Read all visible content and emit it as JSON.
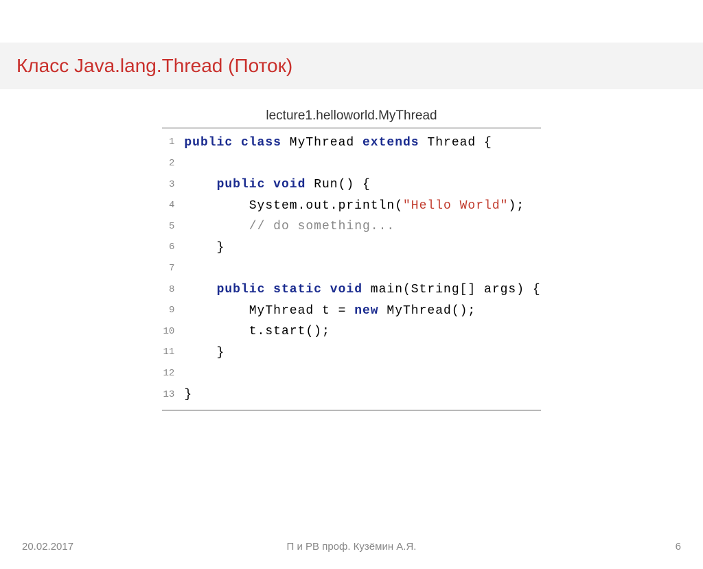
{
  "slide": {
    "title": "Класс Java.lang.Thread (Поток)",
    "code_caption": "lecture1.helloworld.MyThread",
    "lines": [
      {
        "n": "1",
        "tokens": [
          {
            "t": "public class ",
            "c": "kw"
          },
          {
            "t": "MyThread ",
            "c": "plain"
          },
          {
            "t": "extends ",
            "c": "kw"
          },
          {
            "t": "Thread {",
            "c": "plain"
          }
        ]
      },
      {
        "n": "2",
        "tokens": []
      },
      {
        "n": "3",
        "tokens": [
          {
            "t": "    ",
            "c": "plain"
          },
          {
            "t": "public void ",
            "c": "kw"
          },
          {
            "t": "Run() {",
            "c": "plain"
          }
        ]
      },
      {
        "n": "4",
        "tokens": [
          {
            "t": "        System.out.println(",
            "c": "plain"
          },
          {
            "t": "\"Hello World\"",
            "c": "str"
          },
          {
            "t": ");",
            "c": "plain"
          }
        ]
      },
      {
        "n": "5",
        "tokens": [
          {
            "t": "        ",
            "c": "plain"
          },
          {
            "t": "// do something...",
            "c": "com"
          }
        ]
      },
      {
        "n": "6",
        "tokens": [
          {
            "t": "    }",
            "c": "plain"
          }
        ]
      },
      {
        "n": "7",
        "tokens": []
      },
      {
        "n": "8",
        "tokens": [
          {
            "t": "    ",
            "c": "plain"
          },
          {
            "t": "public static void ",
            "c": "kw"
          },
          {
            "t": "main(String[] args) {",
            "c": "plain"
          }
        ]
      },
      {
        "n": "9",
        "tokens": [
          {
            "t": "        MyThread t = ",
            "c": "plain"
          },
          {
            "t": "new ",
            "c": "kw"
          },
          {
            "t": "MyThread();",
            "c": "plain"
          }
        ]
      },
      {
        "n": "10",
        "tokens": [
          {
            "t": "        t.start();",
            "c": "plain"
          }
        ]
      },
      {
        "n": "11",
        "tokens": [
          {
            "t": "    }",
            "c": "plain"
          }
        ]
      },
      {
        "n": "12",
        "tokens": []
      },
      {
        "n": "13",
        "tokens": [
          {
            "t": "}",
            "c": "plain"
          }
        ]
      }
    ]
  },
  "footer": {
    "date": "20.02.2017",
    "center": "П и РВ  проф. Кузёмин А.Я.",
    "page": "6"
  }
}
